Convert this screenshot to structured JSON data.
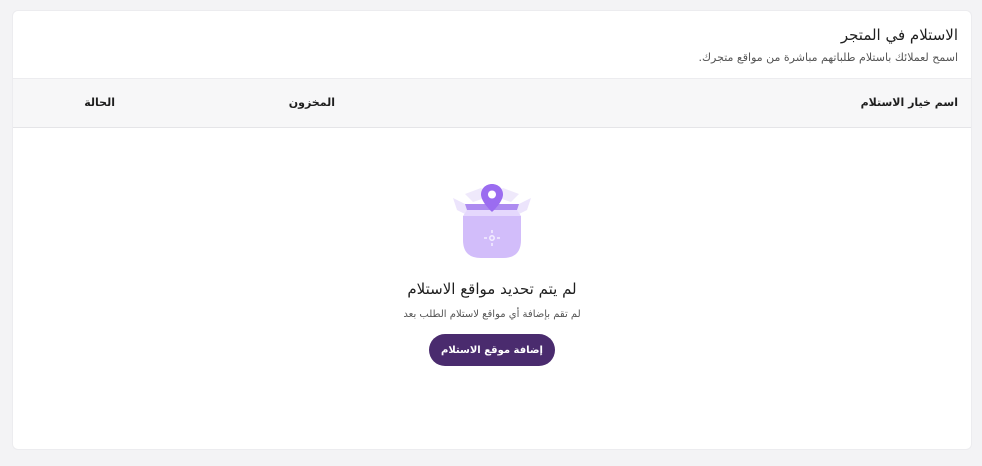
{
  "header": {
    "title": "الاستلام في المتجر",
    "subtitle": "اسمح لعملائك باستلام طلباتهم مباشرة من مواقع متجرك."
  },
  "table": {
    "columns": [
      "اسم خيار الاستلام",
      "المخزون",
      "الحالة"
    ]
  },
  "empty_state": {
    "illustration_icon": "box-location-pin-icon",
    "title": "لم يتم تحديد مواقع الاستلام",
    "subtitle": "لم تقم بإضافة أي مواقع لاستلام الطلب بعد",
    "button_label": "إضافة موقع الاستلام"
  },
  "colors": {
    "accent": "#4a2b6e",
    "illustration_light": "#e9e0fb",
    "illustration_mid": "#c6adf7",
    "pin": "#9b6cf0"
  }
}
